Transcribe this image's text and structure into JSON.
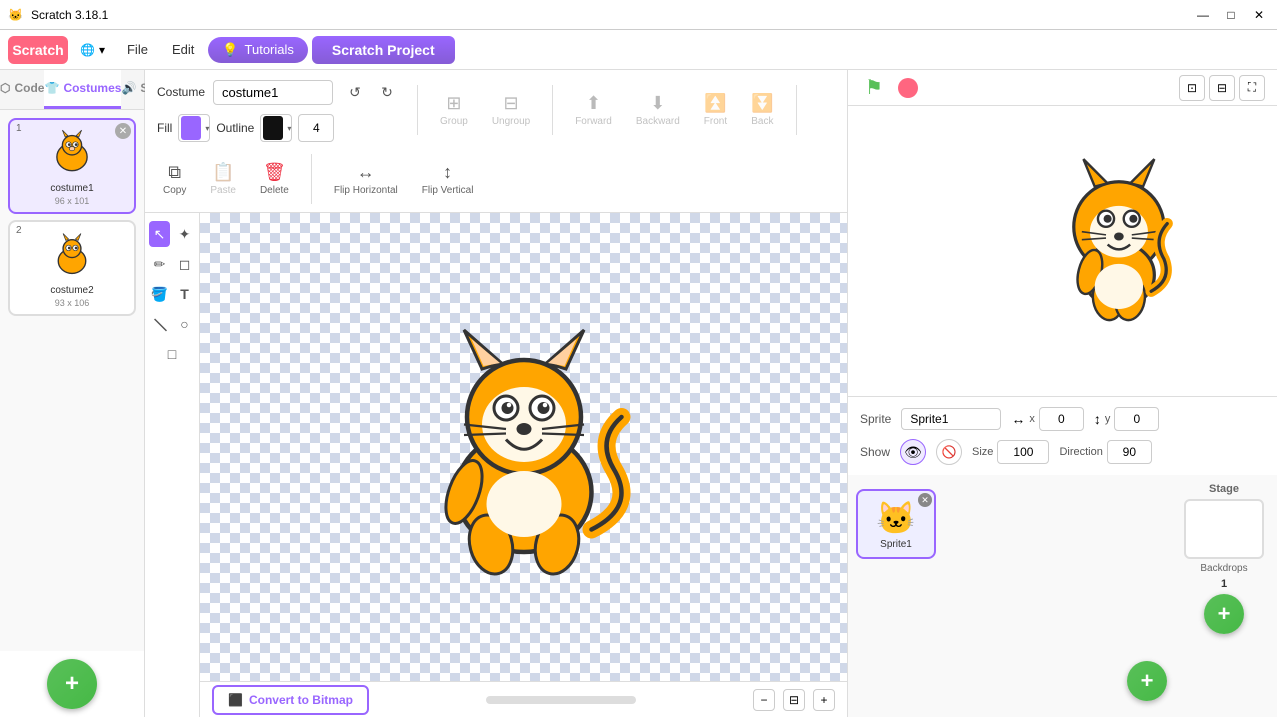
{
  "titlebar": {
    "title": "Scratch 3.18.1",
    "minimize": "—",
    "maximize": "□",
    "close": "✕"
  },
  "menubar": {
    "logo": "Scratch",
    "globe_label": "🌐",
    "file_label": "File",
    "edit_label": "Edit",
    "tutorials_icon": "💡",
    "tutorials_label": "Tutorials",
    "project_title": "Scratch Project"
  },
  "tabs": {
    "code_label": "Code",
    "costumes_label": "Costumes",
    "sounds_label": "Sounds"
  },
  "costume_list": {
    "items": [
      {
        "number": "1",
        "name": "costume1",
        "size": "96 x 101",
        "selected": true
      },
      {
        "number": "2",
        "name": "costume2",
        "size": "93 x 106",
        "selected": false
      }
    ]
  },
  "editor": {
    "costume_label": "Costume",
    "costume_name_value": "costume1",
    "undo_label": "↺",
    "redo_label": "↻",
    "group_label": "Group",
    "ungroup_label": "Ungroup",
    "forward_label": "Forward",
    "backward_label": "Backward",
    "front_label": "Front",
    "back_label": "Back",
    "copy_label": "Copy",
    "paste_label": "Paste",
    "delete_label": "Delete",
    "flip_h_label": "Flip Horizontal",
    "flip_v_label": "Flip Vertical",
    "fill_label": "Fill",
    "fill_color": "#9966FF",
    "outline_label": "Outline",
    "outline_color": "#111111",
    "outline_width": "4"
  },
  "tools": {
    "select": "↖",
    "reshape": "⟋",
    "pencil": "✏",
    "eraser": "◻",
    "fill": "🪣",
    "text": "T",
    "line": "/",
    "circle": "○",
    "rect": "□"
  },
  "canvas": {
    "convert_btn": "Convert to Bitmap",
    "zoom_in": "+",
    "zoom_out": "−",
    "zoom_reset": "⊟"
  },
  "stage_controls": {
    "green_flag_label": "Green Flag",
    "stop_label": "Stop"
  },
  "sprite_info": {
    "sprite_label": "Sprite",
    "sprite_name": "Sprite1",
    "x_label": "x",
    "x_value": "0",
    "y_label": "y",
    "y_value": "0",
    "show_label": "Show",
    "size_label": "Size",
    "size_value": "100",
    "direction_label": "Direction",
    "direction_value": "90"
  },
  "sprite_list": {
    "header": "",
    "sprites": [
      {
        "name": "Sprite1",
        "selected": true
      }
    ]
  },
  "stage_panel": {
    "label": "Stage",
    "backdrops_label": "Backdrops",
    "backdrops_count": "1"
  }
}
